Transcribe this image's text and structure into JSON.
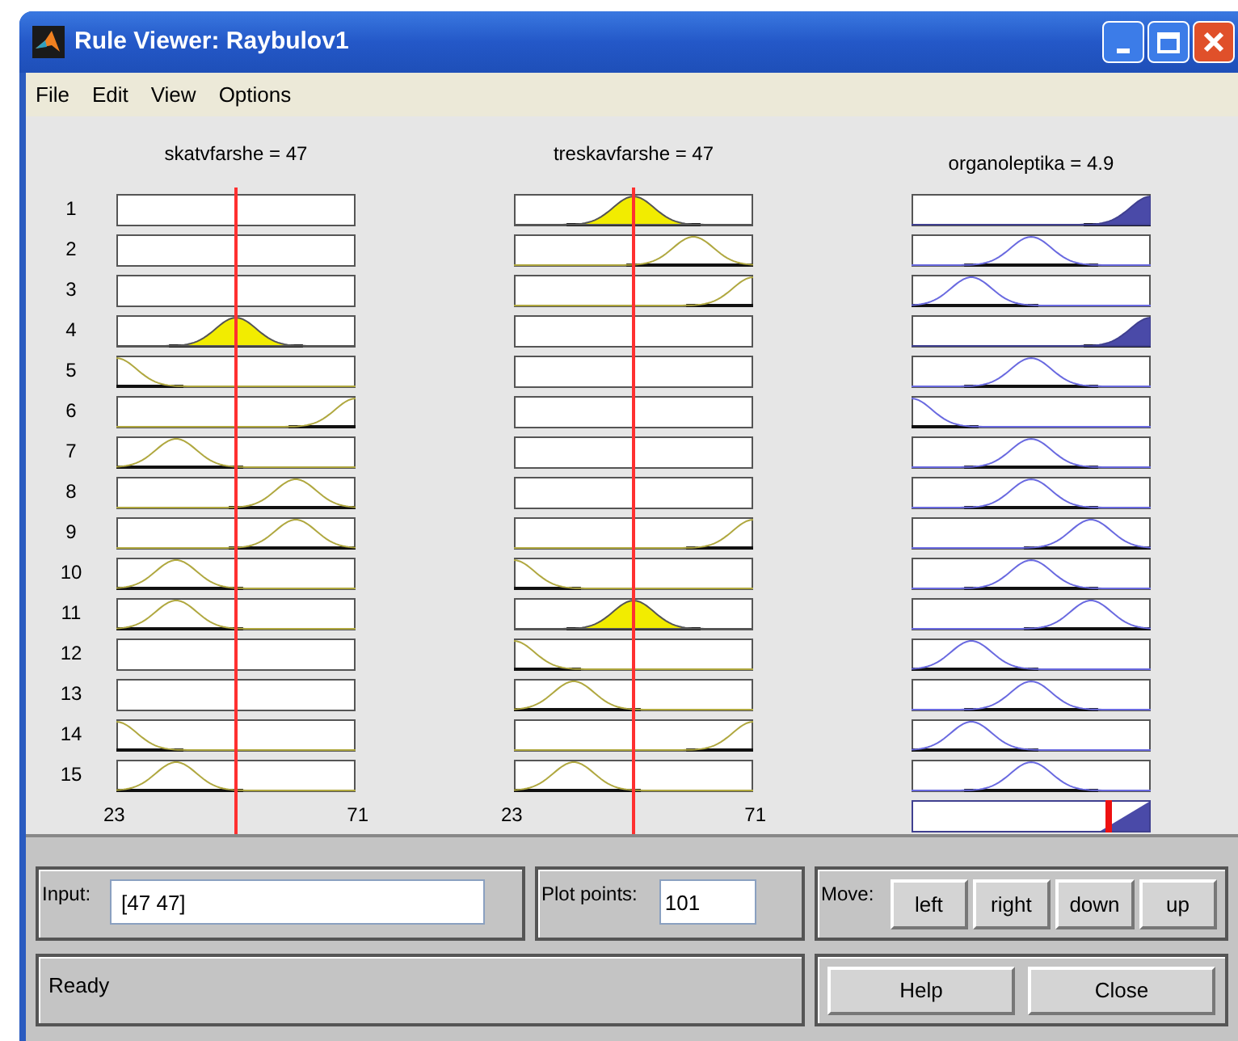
{
  "window": {
    "title": "Rule Viewer: Raybulov1"
  },
  "menu": [
    "File",
    "Edit",
    "View",
    "Options"
  ],
  "rule_numbers": [
    "1",
    "2",
    "3",
    "4",
    "5",
    "6",
    "7",
    "8",
    "9",
    "10",
    "11",
    "12",
    "13",
    "14",
    "15"
  ],
  "variables": [
    {
      "kind": "input",
      "label": "skatvfarshe = 47",
      "ticks": [
        "23",
        "71"
      ],
      "cells": [
        {
          "kind": "none"
        },
        {
          "kind": "none"
        },
        {
          "kind": "none"
        },
        {
          "kind": "mid",
          "fired": true
        },
        {
          "kind": "left",
          "fired": false
        },
        {
          "kind": "right",
          "fired": false
        },
        {
          "kind": "low",
          "fired": false
        },
        {
          "kind": "high",
          "fired": false
        },
        {
          "kind": "high",
          "fired": false
        },
        {
          "kind": "low",
          "fired": false
        },
        {
          "kind": "low",
          "fired": false
        },
        {
          "kind": "none"
        },
        {
          "kind": "none"
        },
        {
          "kind": "left",
          "fired": false
        },
        {
          "kind": "low",
          "fired": false
        }
      ]
    },
    {
      "kind": "input",
      "label": "treskavfarshe = 47",
      "ticks": [
        "23",
        "71"
      ],
      "cells": [
        {
          "kind": "mid",
          "fired": true
        },
        {
          "kind": "high",
          "fired": false
        },
        {
          "kind": "right",
          "fired": false
        },
        {
          "kind": "none"
        },
        {
          "kind": "none"
        },
        {
          "kind": "none"
        },
        {
          "kind": "none"
        },
        {
          "kind": "none"
        },
        {
          "kind": "right",
          "fired": false
        },
        {
          "kind": "left",
          "fired": false
        },
        {
          "kind": "mid",
          "fired": true
        },
        {
          "kind": "left",
          "fired": false
        },
        {
          "kind": "low",
          "fired": false
        },
        {
          "kind": "right",
          "fired": false
        },
        {
          "kind": "low",
          "fired": false
        }
      ]
    },
    {
      "kind": "output",
      "label": "organoleptika = 4.9",
      "level": 0.83,
      "cells": [
        {
          "kind": "right",
          "fired": true
        },
        {
          "kind": "mid",
          "fired": false
        },
        {
          "kind": "low",
          "fired": false
        },
        {
          "kind": "right",
          "fired": true
        },
        {
          "kind": "mid",
          "fired": false
        },
        {
          "kind": "left",
          "fired": false
        },
        {
          "kind": "mid",
          "fired": false
        },
        {
          "kind": "mid",
          "fired": false
        },
        {
          "kind": "high",
          "fired": false
        },
        {
          "kind": "mid",
          "fired": false
        },
        {
          "kind": "high",
          "fired": false
        },
        {
          "kind": "low",
          "fired": false
        },
        {
          "kind": "mid",
          "fired": false
        },
        {
          "kind": "low",
          "fired": false
        },
        {
          "kind": "mid",
          "fired": false
        }
      ]
    }
  ],
  "input": {
    "label": "Input:",
    "value": "[47 47]"
  },
  "plot_points": {
    "label": "Plot points:",
    "value": "101"
  },
  "move": {
    "label": "Move:",
    "buttons": [
      "left",
      "right",
      "down",
      "up"
    ]
  },
  "status": "Ready",
  "buttons": [
    "Help",
    "Close"
  ]
}
